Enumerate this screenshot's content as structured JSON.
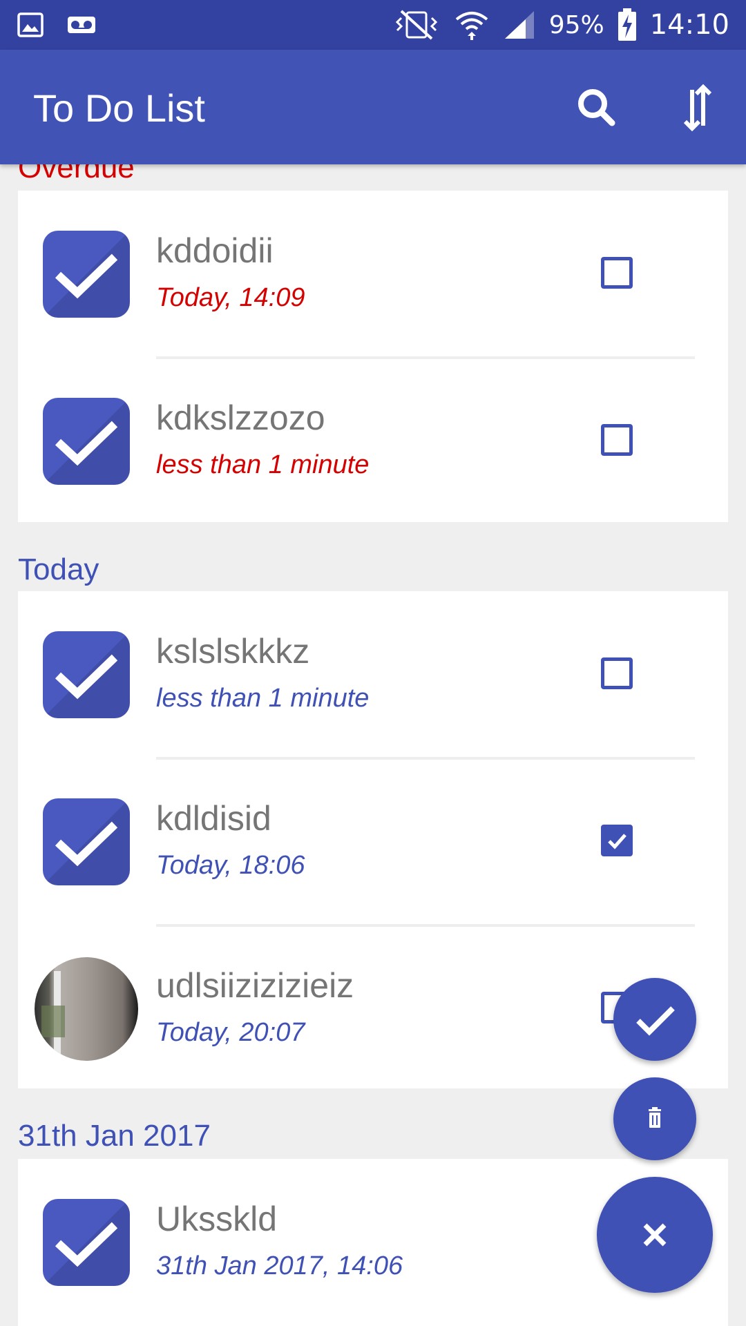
{
  "status_bar": {
    "icons": [
      "image-icon",
      "voicemail-icon",
      "vibrate-icon",
      "wifi-icon",
      "signal-icon",
      "battery-charging-icon"
    ],
    "battery": "95%",
    "time": "14:10"
  },
  "app_bar": {
    "title": "To Do List",
    "actions": [
      "search-icon",
      "sort-icon"
    ]
  },
  "sections": [
    {
      "label": "Overdue",
      "color": "#d50000",
      "items": [
        {
          "name": "kddoidii",
          "due": "Today, 14:09",
          "checked": false,
          "avatar": "check-tile"
        },
        {
          "name": "kdkslzzozo",
          "due": "less than 1 minute",
          "checked": false,
          "avatar": "check-tile"
        }
      ]
    },
    {
      "label": "Today",
      "color": "#3f51b5",
      "items": [
        {
          "name": "kslslskkkz",
          "due": "less than 1 minute",
          "checked": false,
          "avatar": "check-tile"
        },
        {
          "name": "kdldisid",
          "due": "Today, 18:06",
          "checked": true,
          "avatar": "check-tile"
        },
        {
          "name": "udlsiizizizieiz",
          "due": "Today, 20:07",
          "checked": false,
          "avatar": "photo"
        }
      ]
    },
    {
      "label": "31th Jan 2017",
      "color": "#3f51b5",
      "items": [
        {
          "name": "Uksskld",
          "due": "31th Jan 2017, 14:06",
          "checked": false,
          "avatar": "check-tile"
        }
      ]
    }
  ],
  "fabs": [
    "check-icon",
    "trash-icon",
    "close-icon"
  ],
  "colors": {
    "primary": "#4154b6",
    "primary_dark": "#3341a0",
    "accent": "#3f51b5",
    "overdue": "#d50000",
    "title_text": "#757575",
    "background": "#efefef"
  }
}
